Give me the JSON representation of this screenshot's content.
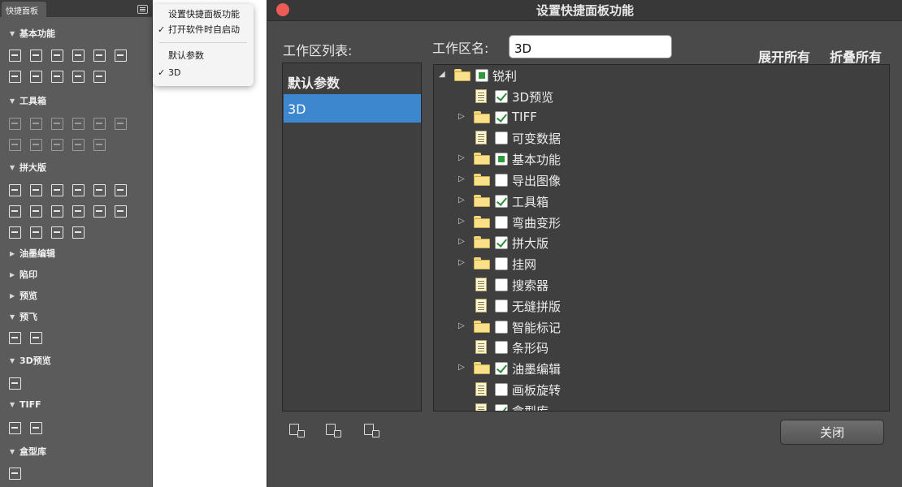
{
  "panel": {
    "tab_label": "快捷面板",
    "sections": [
      {
        "label": "基本功能",
        "expanded": true
      },
      {
        "label": "工具箱",
        "expanded": true
      },
      {
        "label": "拼大版",
        "expanded": true
      },
      {
        "label": "油墨编辑",
        "expanded": false
      },
      {
        "label": "陷印",
        "expanded": false
      },
      {
        "label": "预览",
        "expanded": false
      },
      {
        "label": "预飞",
        "expanded": true
      },
      {
        "label": "3D预览",
        "expanded": true
      },
      {
        "label": "TIFF",
        "expanded": true
      },
      {
        "label": "盒型库",
        "expanded": true
      }
    ],
    "arrow_expanded": "▼",
    "arrow_collapsed": "▶"
  },
  "dropdown": {
    "items": [
      {
        "label": "设置快捷面板功能",
        "checked": false
      },
      {
        "label": "打开软件时自启动",
        "checked": true
      },
      {
        "label": "默认参数",
        "checked": false
      },
      {
        "label": "3D",
        "checked": true
      }
    ],
    "check_glyph": "✓"
  },
  "dialog": {
    "title": "设置快捷面板功能",
    "workspace_list_label": "工作区列表:",
    "workspace_name_label": "工作区名:",
    "workspace_name_value": "3D",
    "expand_all": "展开所有",
    "collapse_all": "折叠所有",
    "close_button": "关闭",
    "workspaces": [
      {
        "label": "默认参数",
        "selected": false
      },
      {
        "label": "3D",
        "selected": true
      }
    ],
    "tree": [
      {
        "label": "锐利",
        "type": "folder",
        "level": 0,
        "expander": "◢",
        "state": "partial"
      },
      {
        "label": "3D预览",
        "type": "doc",
        "level": 1,
        "expander": "",
        "state": "checked"
      },
      {
        "label": "TIFF",
        "type": "folder",
        "level": 1,
        "expander": "▷",
        "state": "checked"
      },
      {
        "label": "可变数据",
        "type": "doc",
        "level": 1,
        "expander": "",
        "state": "unchecked"
      },
      {
        "label": "基本功能",
        "type": "folder",
        "level": 1,
        "expander": "▷",
        "state": "partial"
      },
      {
        "label": "导出图像",
        "type": "folder",
        "level": 1,
        "expander": "▷",
        "state": "unchecked"
      },
      {
        "label": "工具箱",
        "type": "folder",
        "level": 1,
        "expander": "▷",
        "state": "checked"
      },
      {
        "label": "弯曲变形",
        "type": "folder",
        "level": 1,
        "expander": "▷",
        "state": "unchecked"
      },
      {
        "label": "拼大版",
        "type": "folder",
        "level": 1,
        "expander": "▷",
        "state": "checked"
      },
      {
        "label": "挂网",
        "type": "folder",
        "level": 1,
        "expander": "▷",
        "state": "unchecked"
      },
      {
        "label": "搜索器",
        "type": "doc",
        "level": 1,
        "expander": "",
        "state": "unchecked"
      },
      {
        "label": "无缝拼版",
        "type": "doc",
        "level": 1,
        "expander": "",
        "state": "unchecked"
      },
      {
        "label": "智能标记",
        "type": "folder",
        "level": 1,
        "expander": "▷",
        "state": "unchecked"
      },
      {
        "label": "条形码",
        "type": "doc",
        "level": 1,
        "expander": "",
        "state": "unchecked"
      },
      {
        "label": "油墨编辑",
        "type": "folder",
        "level": 1,
        "expander": "▷",
        "state": "checked"
      },
      {
        "label": "画板旋转",
        "type": "doc",
        "level": 1,
        "expander": "",
        "state": "unchecked"
      },
      {
        "label": "盒型库",
        "type": "doc",
        "level": 1,
        "expander": "",
        "state": "checked"
      }
    ]
  }
}
